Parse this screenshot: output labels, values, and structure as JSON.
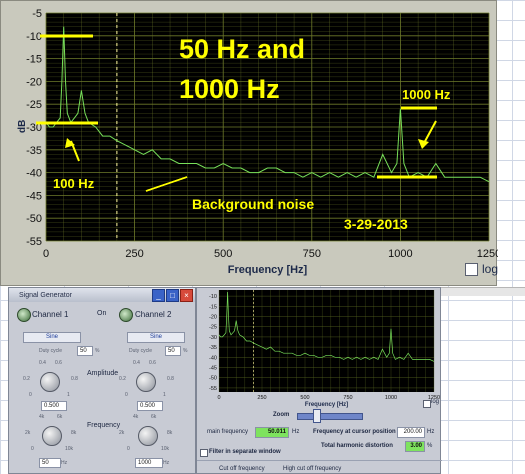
{
  "main_chart": {
    "title_line1": "50 Hz and",
    "title_line2": "1000 Hz",
    "annotation_100hz": "100 Hz",
    "annotation_1000hz": "1000 Hz",
    "annotation_noise": "Background noise",
    "annotation_date": "3-29-2013",
    "xlabel": "Frequency [Hz]",
    "ylabel": "dB",
    "log_label": "log",
    "xticks": [
      "0",
      "250",
      "500",
      "750",
      "1000",
      "1250"
    ],
    "yticks": [
      "-5",
      "-10",
      "-15",
      "-20",
      "-25",
      "-30",
      "-35",
      "-40",
      "-45",
      "-50",
      "-55"
    ],
    "colors": {
      "background": "#000000",
      "grid": "#6e7a2a",
      "trace": "#78e05a",
      "annotation": "#ffff00"
    }
  },
  "chart_data": [
    {
      "type": "line",
      "xlabel": "Frequency [Hz]",
      "ylabel": "dB",
      "xlim": [
        0,
        1250
      ],
      "ylim": [
        -55,
        -5
      ],
      "log_scale": false,
      "grid": true,
      "cursor_x": 200,
      "series": [
        {
          "x": [
            0,
            10,
            20,
            30,
            40,
            45,
            50,
            55,
            60,
            70,
            80,
            90,
            100,
            110,
            120,
            140,
            150,
            160,
            180,
            200,
            225,
            250,
            275,
            300,
            325,
            350,
            375,
            400,
            425,
            450,
            475,
            500,
            525,
            550,
            575,
            600,
            625,
            650,
            675,
            700,
            725,
            750,
            775,
            800,
            825,
            850,
            875,
            900,
            925,
            950,
            975,
            990,
            1000,
            1010,
            1025,
            1050,
            1075,
            1100,
            1125,
            1150,
            1175,
            1200,
            1225,
            1250
          ],
          "y": [
            -29,
            -30,
            -30,
            -29,
            -28,
            -20,
            -8,
            -20,
            -27,
            -29,
            -28,
            -27,
            -22,
            -27,
            -29,
            -30,
            -31,
            -32,
            -32,
            -33,
            -34,
            -35,
            -36,
            -35,
            -37,
            -37,
            -38,
            -38,
            -38,
            -39,
            -39,
            -38,
            -39,
            -39,
            -40,
            -40,
            -39,
            -39,
            -40,
            -40,
            -41,
            -40,
            -41,
            -40,
            -41,
            -40,
            -41,
            -40,
            -41,
            -36,
            -40,
            -38,
            -26,
            -38,
            -41,
            -40,
            -41,
            -38,
            -41,
            -41,
            -41,
            -41,
            -41,
            -42
          ]
        }
      ]
    }
  ],
  "signal_generator": {
    "title": "Signal Generator",
    "channel1": "Channel 1",
    "channel2": "Channel 2",
    "on_label": "On",
    "wave1": "Sine",
    "wave2": "Sine",
    "duty_label": "Duty cycle",
    "duty1": "50",
    "duty2": "50",
    "duty_unit": "%",
    "amplitude_label": "Amplitude",
    "amp_ticks": [
      "0.4",
      "0.6",
      "0.2",
      "0.8",
      "0",
      "1"
    ],
    "amp1_value": "0.500",
    "amp2_value": "0.500",
    "frequency_label": "Frequency",
    "freq_ticks": [
      "4k",
      "6k",
      "2k",
      "8k",
      "0",
      "10k"
    ],
    "freq1_value": "50",
    "freq2_value": "1000",
    "hz_unit": "Hz"
  },
  "spectrum_panel": {
    "small_yticks": [
      "-10",
      "-15",
      "-20",
      "-25",
      "-30",
      "-35",
      "-40",
      "-45",
      "-50",
      "-55"
    ],
    "small_xticks": [
      "0",
      "250",
      "500",
      "750",
      "1000",
      "1250"
    ],
    "xlabel": "Frequency [Hz]",
    "log_label": "log",
    "zoom_label": "Zoom",
    "main_frequency_label": "main frequency",
    "main_frequency_value": "50.011",
    "hz_unit": "Hz",
    "cursor_label": "Frequency at cursor position",
    "cursor_value": "200.00",
    "thd_label": "Total harmonic distortion",
    "thd_value": "3.00",
    "percent_unit": "%",
    "filter_label": "Filter in separate window",
    "cutoff_label": "Cut off frequency",
    "high_cutoff_label": "High cut off frequency"
  }
}
